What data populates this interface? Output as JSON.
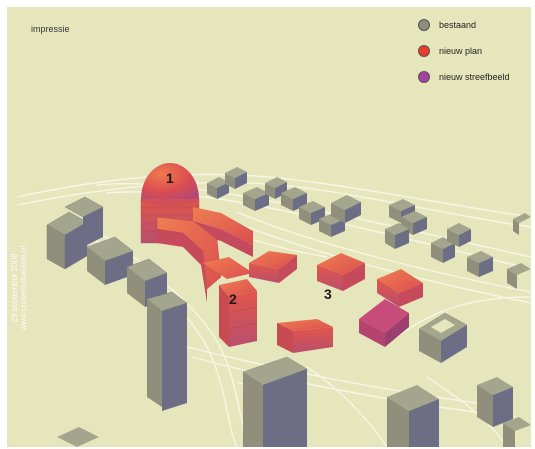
{
  "title": "impressie",
  "legend": [
    {
      "label": "bestaand",
      "color": "#8c8f7e"
    },
    {
      "label": "nieuw plan",
      "color": "#ee3c2a"
    },
    {
      "label": "nieuw streefbeeld",
      "color": "#a8409e"
    }
  ],
  "markers": [
    "1",
    "2",
    "3"
  ],
  "side_text": {
    "website": "www.crusenurbanism.nl",
    "date": "29 september 2008"
  },
  "colors": {
    "background": "#e6e6bd",
    "existing_top": "#a3a68c",
    "existing_side": "#6d6d86",
    "plan_top": "#e26a4e",
    "plan_side": "#c94b52",
    "road_line": "#f4f4e2"
  }
}
